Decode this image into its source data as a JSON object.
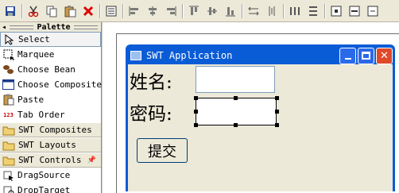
{
  "toolbar": {
    "icons": [
      "save-icon",
      "cut-icon",
      "copy-icon",
      "paste-icon",
      "delete-icon",
      "properties-icon",
      "align-left-icon",
      "align-center-icon",
      "align-right-icon",
      "align-top-icon",
      "align-middle-icon",
      "align-bottom-icon",
      "match-width-icon",
      "match-height-icon",
      "distribute-horizontal-icon",
      "distribute-vertical-icon",
      "center-horizontal-icon",
      "center-vertical-icon",
      "test-icon"
    ]
  },
  "palette": {
    "title": "Palette",
    "tools": [
      {
        "label": "Select",
        "icon": "arrow-icon"
      },
      {
        "label": "Marquee",
        "icon": "marquee-icon"
      },
      {
        "label": "Choose Bean",
        "icon": "bean-icon"
      },
      {
        "label": "Choose Composite",
        "icon": "composite-icon"
      },
      {
        "label": "Paste",
        "icon": "paste-icon"
      },
      {
        "label": "Tab Order",
        "icon": "tab-order-icon"
      }
    ],
    "drawers": [
      {
        "label": "SWT Composites"
      },
      {
        "label": "SWT Layouts"
      },
      {
        "label": "SWT Controls"
      }
    ],
    "controls": [
      {
        "label": "DragSource"
      },
      {
        "label": "DropTarget"
      }
    ],
    "tab_order_numbers": "123"
  },
  "window": {
    "title": "SWT Application",
    "name_label": "姓名:",
    "password_label": "密码:",
    "submit_label": "提交"
  },
  "colors": {
    "titlebar": "#0a5cd6",
    "window_bg": "#ece9d8",
    "close_button": "#e04a2a"
  }
}
